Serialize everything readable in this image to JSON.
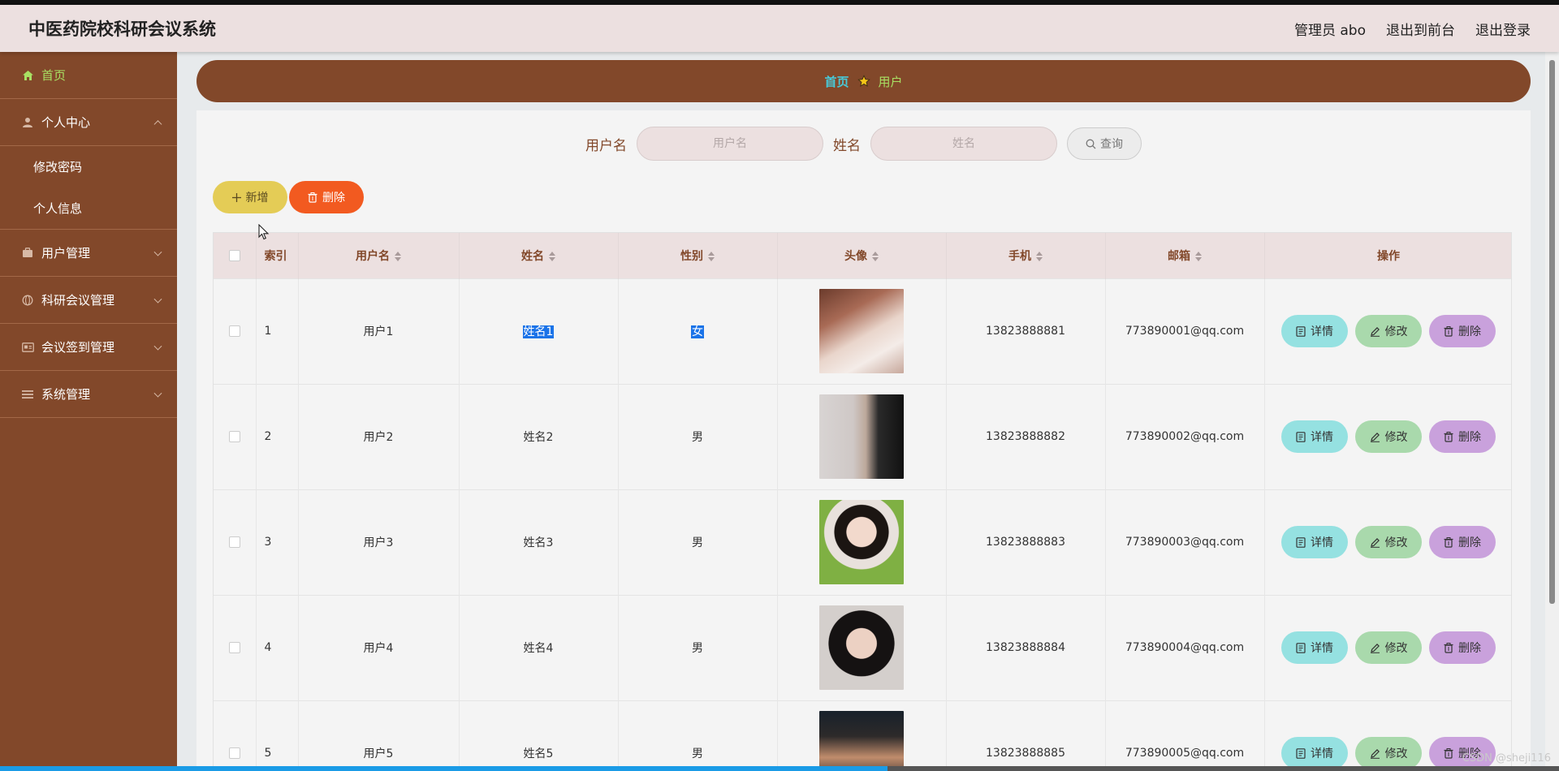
{
  "app": {
    "title": "中医药院校科研会议系统"
  },
  "header": {
    "user": "管理员 abo",
    "to_front": "退出到前台",
    "logout": "退出登录"
  },
  "sidebar": {
    "home": "首页",
    "personal": "个人中心",
    "personal_items": [
      "修改密码",
      "个人信息"
    ],
    "user_mgmt": "用户管理",
    "meeting_mgmt": "科研会议管理",
    "signin_mgmt": "会议签到管理",
    "system_mgmt": "系统管理"
  },
  "breadcrumb": {
    "home": "首页",
    "current": "用户"
  },
  "search": {
    "username_label": "用户名",
    "username_placeholder": "用户名",
    "name_label": "姓名",
    "name_placeholder": "姓名",
    "query_button": "查询"
  },
  "actions": {
    "add": "新增",
    "delete": "删除"
  },
  "table": {
    "columns": [
      "索引",
      "用户名",
      "姓名",
      "性别",
      "头像",
      "手机",
      "邮箱",
      "操作"
    ],
    "rows": [
      {
        "index": "1",
        "username": "用户1",
        "name": "姓名1",
        "gender": "女",
        "phone": "13823888881",
        "email": "773890001@qq.com"
      },
      {
        "index": "2",
        "username": "用户2",
        "name": "姓名2",
        "gender": "男",
        "phone": "13823888882",
        "email": "773890002@qq.com"
      },
      {
        "index": "3",
        "username": "用户3",
        "name": "姓名3",
        "gender": "男",
        "phone": "13823888883",
        "email": "773890003@qq.com"
      },
      {
        "index": "4",
        "username": "用户4",
        "name": "姓名4",
        "gender": "男",
        "phone": "13823888884",
        "email": "773890004@qq.com"
      },
      {
        "index": "5",
        "username": "用户5",
        "name": "姓名5",
        "gender": "男",
        "phone": "13823888885",
        "email": "773890005@qq.com"
      }
    ],
    "row_actions": {
      "detail": "详情",
      "edit": "修改",
      "delete": "删除"
    }
  },
  "watermark": "CSDN @sheji116",
  "colors": {
    "brand": "#82482a",
    "header_bg": "#ece0e0",
    "active_menu": "#a8e063",
    "add_button": "#e4cc56",
    "delete_button": "#f25a20"
  }
}
